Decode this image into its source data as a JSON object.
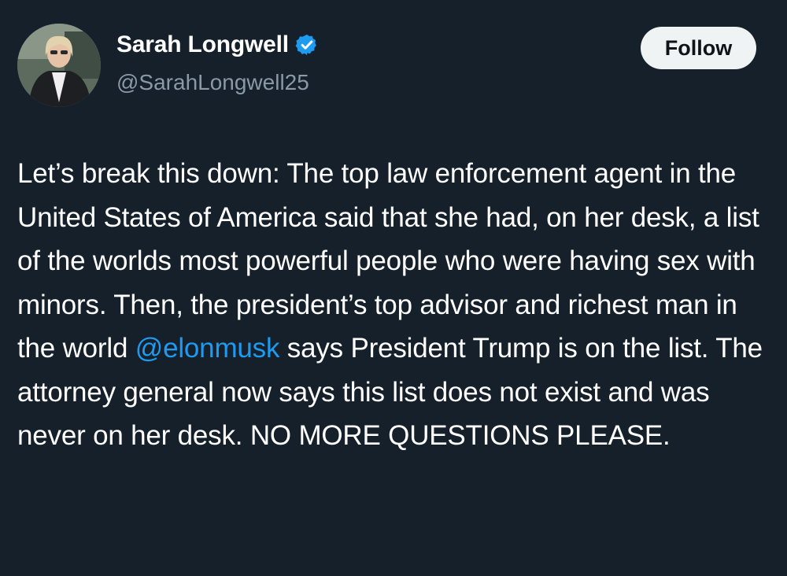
{
  "author": {
    "display_name": "Sarah Longwell",
    "handle": "@SarahLongwell25",
    "verified_icon": "verified-badge-icon",
    "avatar_icon": "profile-photo"
  },
  "follow_button": {
    "label": "Follow"
  },
  "tweet": {
    "text_part1": "Let’s break this down: The top law enforcement agent in the United States of America said that she had, on her desk, a list of the worlds most powerful people who were having sex with minors. Then, the president’s top advisor and richest man in the world ",
    "mention": "@elonmusk",
    "text_part2": " says President Trump is on the list. The attorney general now says this list does not exist and was never on her desk. NO MORE QUESTIONS PLEASE."
  },
  "colors": {
    "background": "#15202b",
    "text": "#ffffff",
    "secondary_text": "#8b98a5",
    "link": "#1d9bf0",
    "verified": "#1d9bf0",
    "button_bg": "#eff3f4",
    "button_text": "#0f1419"
  }
}
